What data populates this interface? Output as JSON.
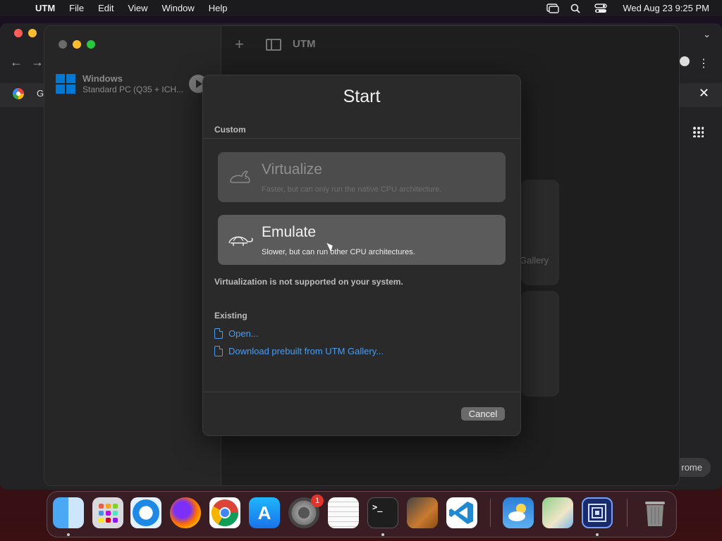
{
  "menubar": {
    "apple": "",
    "app": "UTM",
    "items": [
      "File",
      "Edit",
      "View",
      "Window",
      "Help"
    ],
    "clock": "Wed Aug 23  9:25 PM",
    "icons": [
      "screen-mirroring-icon",
      "search-icon",
      "control-center-icon"
    ]
  },
  "chrome": {
    "tab_letter": "G",
    "bottom_button": "rome",
    "icons": [
      "back-arrow-icon",
      "forward-arrow-icon",
      "google-logo-icon",
      "profile-icon",
      "kebab-menu-icon",
      "chevron-down-icon",
      "close-icon",
      "apps-grid-icon"
    ]
  },
  "utm": {
    "toolbar_title": "UTM",
    "vm": {
      "name": "Windows",
      "subtitle": "Standard PC (Q35 + ICH..."
    },
    "bg_card_text": "Gallery"
  },
  "sheet": {
    "title": "Start",
    "custom_label": "Custom",
    "virtualize": {
      "title": "Virtualize",
      "subtitle": "Faster, but can only run the native CPU architecture."
    },
    "emulate": {
      "title": "Emulate",
      "subtitle": "Slower, but can run other CPU architectures."
    },
    "note": "Virtualization is not supported on your system.",
    "existing_label": "Existing",
    "open_link": "Open...",
    "download_link": "Download prebuilt from UTM Gallery...",
    "cancel": "Cancel"
  },
  "dock": {
    "apps": [
      "Finder",
      "Launchpad",
      "Safari",
      "Firefox",
      "Chrome",
      "App Store",
      "System Settings",
      "TextEdit",
      "Terminal",
      "GarageBand",
      "Visual Studio Code",
      "Weather",
      "Maps",
      "UTM",
      "Trash"
    ],
    "settings_badge": "1",
    "terminal_glyph": ">_"
  },
  "colors": {
    "accent_link": "#4a9cf0",
    "close": "#ff5f57",
    "minimize": "#febc2e",
    "zoom": "#28c840"
  }
}
